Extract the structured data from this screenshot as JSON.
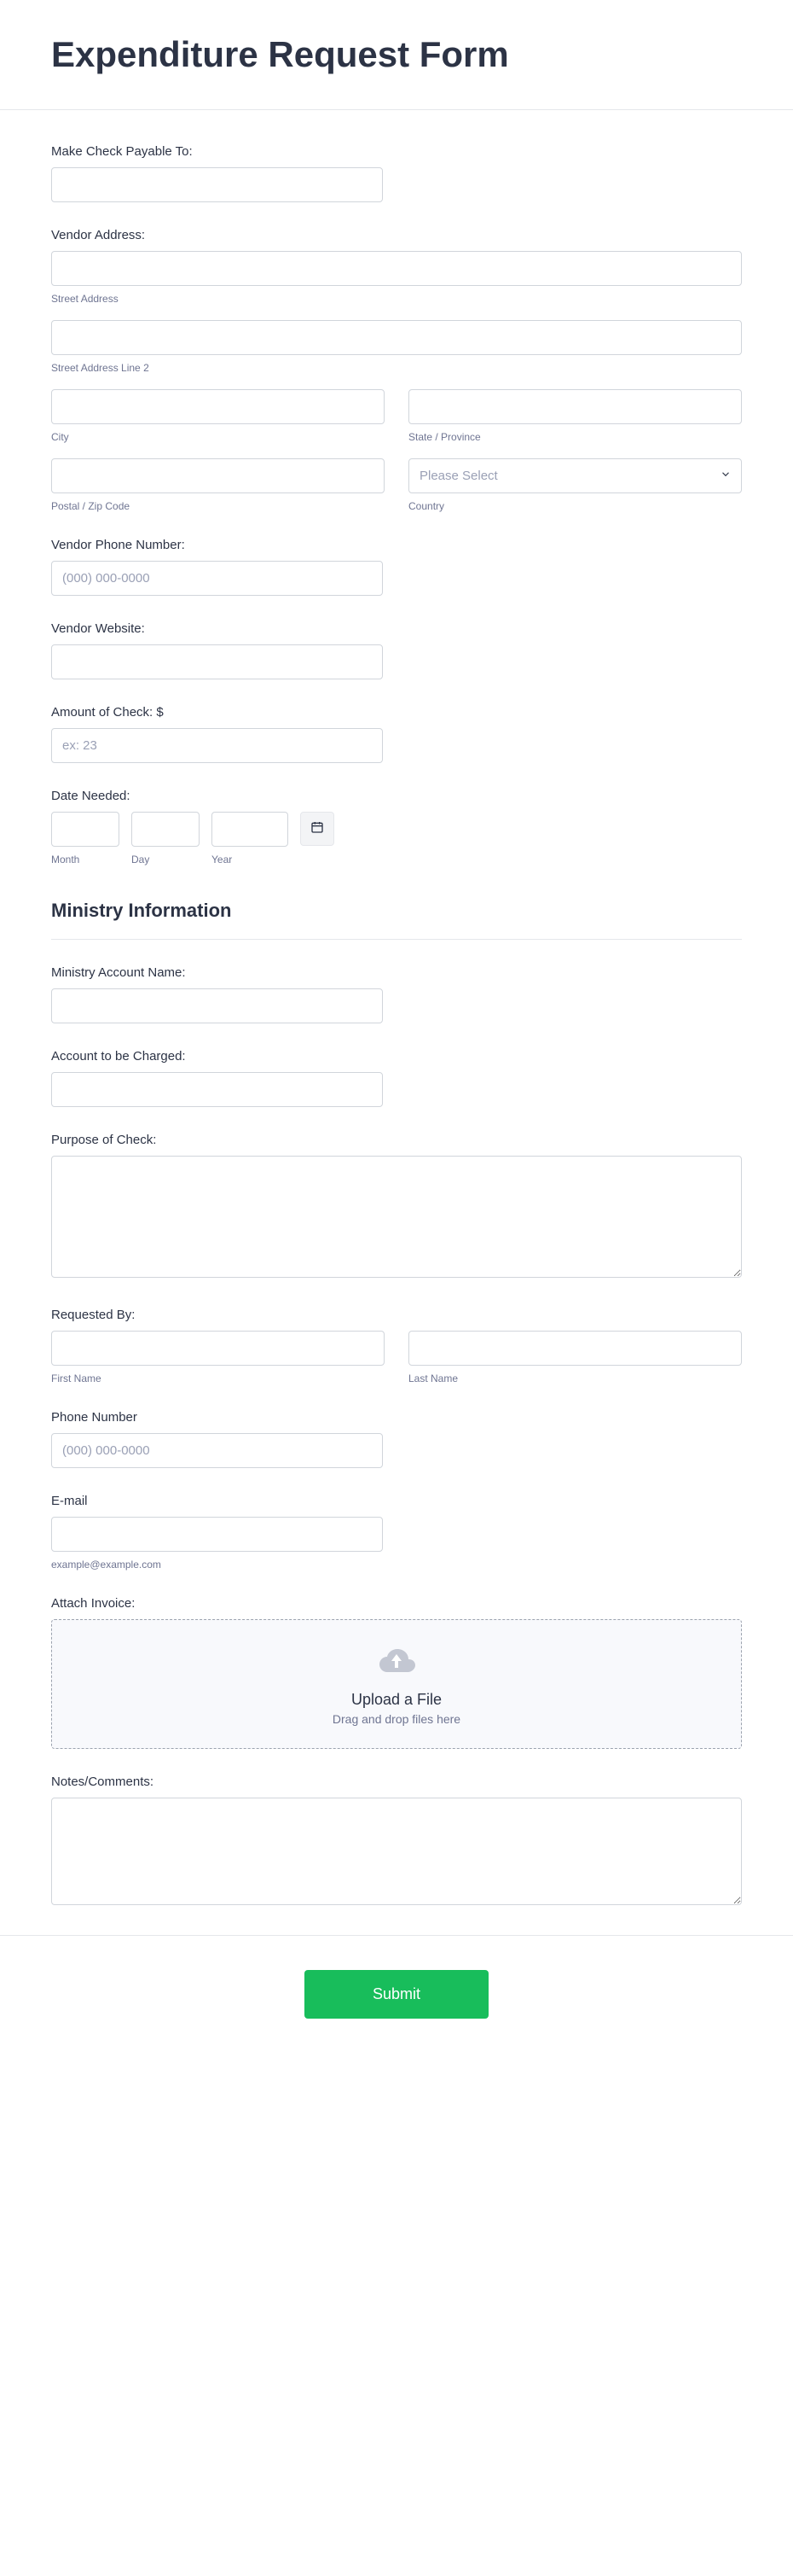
{
  "title": "Expenditure Request Form",
  "payee": {
    "label": "Make Check Payable To:"
  },
  "vendor_address": {
    "label": "Vendor Address:",
    "street_sub": "Street Address",
    "street2_sub": "Street Address Line 2",
    "city_sub": "City",
    "state_sub": "State / Province",
    "postal_sub": "Postal / Zip Code",
    "country_sub": "Country",
    "country_placeholder": "Please Select"
  },
  "vendor_phone": {
    "label": "Vendor Phone Number:",
    "placeholder": "(000) 000-0000"
  },
  "vendor_website": {
    "label": "Vendor Website:"
  },
  "amount": {
    "label": "Amount of Check: $",
    "placeholder": "ex: 23"
  },
  "date_needed": {
    "label": "Date Needed:",
    "month_sub": "Month",
    "day_sub": "Day",
    "year_sub": "Year"
  },
  "ministry": {
    "section": "Ministry Information",
    "account_name_label": "Ministry Account Name:",
    "account_charged_label": "Account to be Charged:",
    "purpose_label": "Purpose of Check:"
  },
  "requested_by": {
    "label": "Requested By:",
    "first_sub": "First Name",
    "last_sub": "Last Name"
  },
  "phone": {
    "label": "Phone Number",
    "placeholder": "(000) 000-0000"
  },
  "email": {
    "label": "E-mail",
    "hint": "example@example.com"
  },
  "attach": {
    "label": "Attach Invoice:",
    "title": "Upload a File",
    "sub": "Drag and drop files here"
  },
  "notes": {
    "label": "Notes/Comments:"
  },
  "submit": {
    "label": "Submit"
  }
}
